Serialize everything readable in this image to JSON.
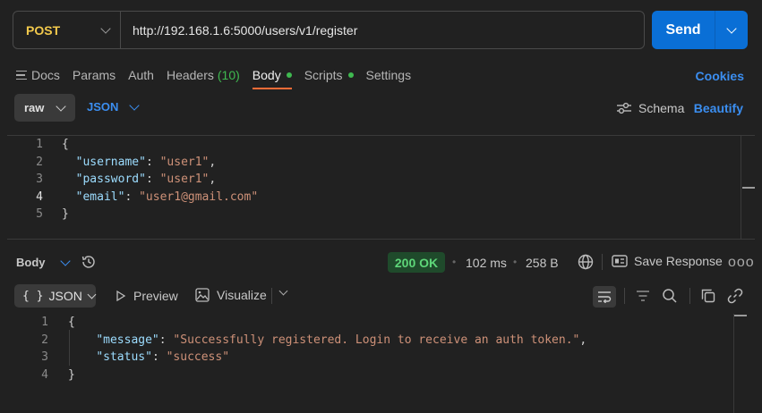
{
  "request": {
    "method": "POST",
    "url": "http://192.168.1.6:5000/users/v1/register",
    "send_label": "Send"
  },
  "tabs": [
    {
      "label": "Docs"
    },
    {
      "label": "Params"
    },
    {
      "label": "Auth"
    },
    {
      "label": "Headers",
      "count": "(10)"
    },
    {
      "label": "Body",
      "active": true,
      "dot": true
    },
    {
      "label": "Scripts",
      "dot": true
    },
    {
      "label": "Settings"
    }
  ],
  "cookies_label": "Cookies",
  "body_mode": {
    "mode": "raw",
    "format": "JSON",
    "schema_label": "Schema",
    "beautify_label": "Beautify"
  },
  "request_body": {
    "line_numbers": [
      "1",
      "2",
      "3",
      "4",
      "5"
    ],
    "open_brace": "{",
    "close_brace": "}",
    "fields": [
      {
        "key": "\"username\"",
        "value": "\"user1\"",
        "trail": ","
      },
      {
        "key": "\"password\"",
        "value": "\"user1\"",
        "trail": ","
      },
      {
        "key": "\"email\"",
        "value": "\"user1@gmail.com\"",
        "trail": ""
      }
    ]
  },
  "response": {
    "body_label": "Body",
    "status": "200 OK",
    "time": "102 ms",
    "size": "258 B",
    "save_label": "Save Response",
    "more": "ooo",
    "view_braces": "{ }",
    "view_mode": "JSON",
    "preview_label": "Preview",
    "visualize_label": "Visualize",
    "line_numbers": [
      "1",
      "2",
      "3",
      "4"
    ],
    "open_brace": "{",
    "close_brace": "}",
    "fields": [
      {
        "key": "\"message\"",
        "value": "\"Successfully registered. Login to receive an auth token.\"",
        "trail": ","
      },
      {
        "key": "\"status\"",
        "value": "\"success\"",
        "trail": ""
      }
    ]
  },
  "colors": {
    "background": "#212121",
    "accent": "#0a6fd6",
    "link": "#3b8ef0",
    "method": "#f2c94c",
    "ok": "#5ed679",
    "active_tab_underline": "#ff6c37",
    "json_key": "#9cdcfe",
    "json_string": "#ce9178"
  }
}
